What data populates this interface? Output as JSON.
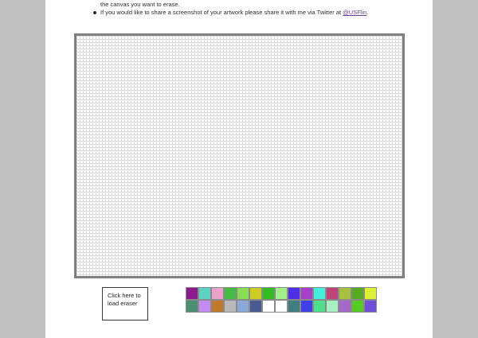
{
  "instructions": {
    "partial_line": "the canvas you want to erase.",
    "share_text": "If you would like to share a screenshot of your artwork please share it with me via Twitter at ",
    "share_link": "@USFlin",
    "share_suffix": "."
  },
  "colors": {
    "side_panel": "#c1c1c1",
    "canvas_border": "#7f7f7f",
    "grid_line": "#d9d9d9",
    "link": "#6b3fa0"
  },
  "eraser_button": {
    "lines": [
      "Click here to",
      "load eraser"
    ]
  },
  "palette": {
    "rows": [
      [
        "#8b1c8b",
        "#5fd3c3",
        "#e9a3c9",
        "#44bb44",
        "#88dd55",
        "#cccc22",
        "#33bb22",
        "#a3f08a",
        "#4f2ee8",
        "#a83fc8",
        "#44eedd",
        "#c0447a",
        "#a8c040",
        "#55aa22",
        "#ddf033"
      ],
      [
        "#4c8f72",
        "#c38cf0",
        "#c0782a",
        "#b8b8b8",
        "#8aa8d8",
        "#4a5a92",
        "#ffffff",
        "#ffffff",
        "#3f7f80",
        "#4040e8",
        "#4ce08a",
        "#a6f0c4",
        "#a468c8",
        "#55cc22",
        "#7050d8"
      ]
    ]
  }
}
